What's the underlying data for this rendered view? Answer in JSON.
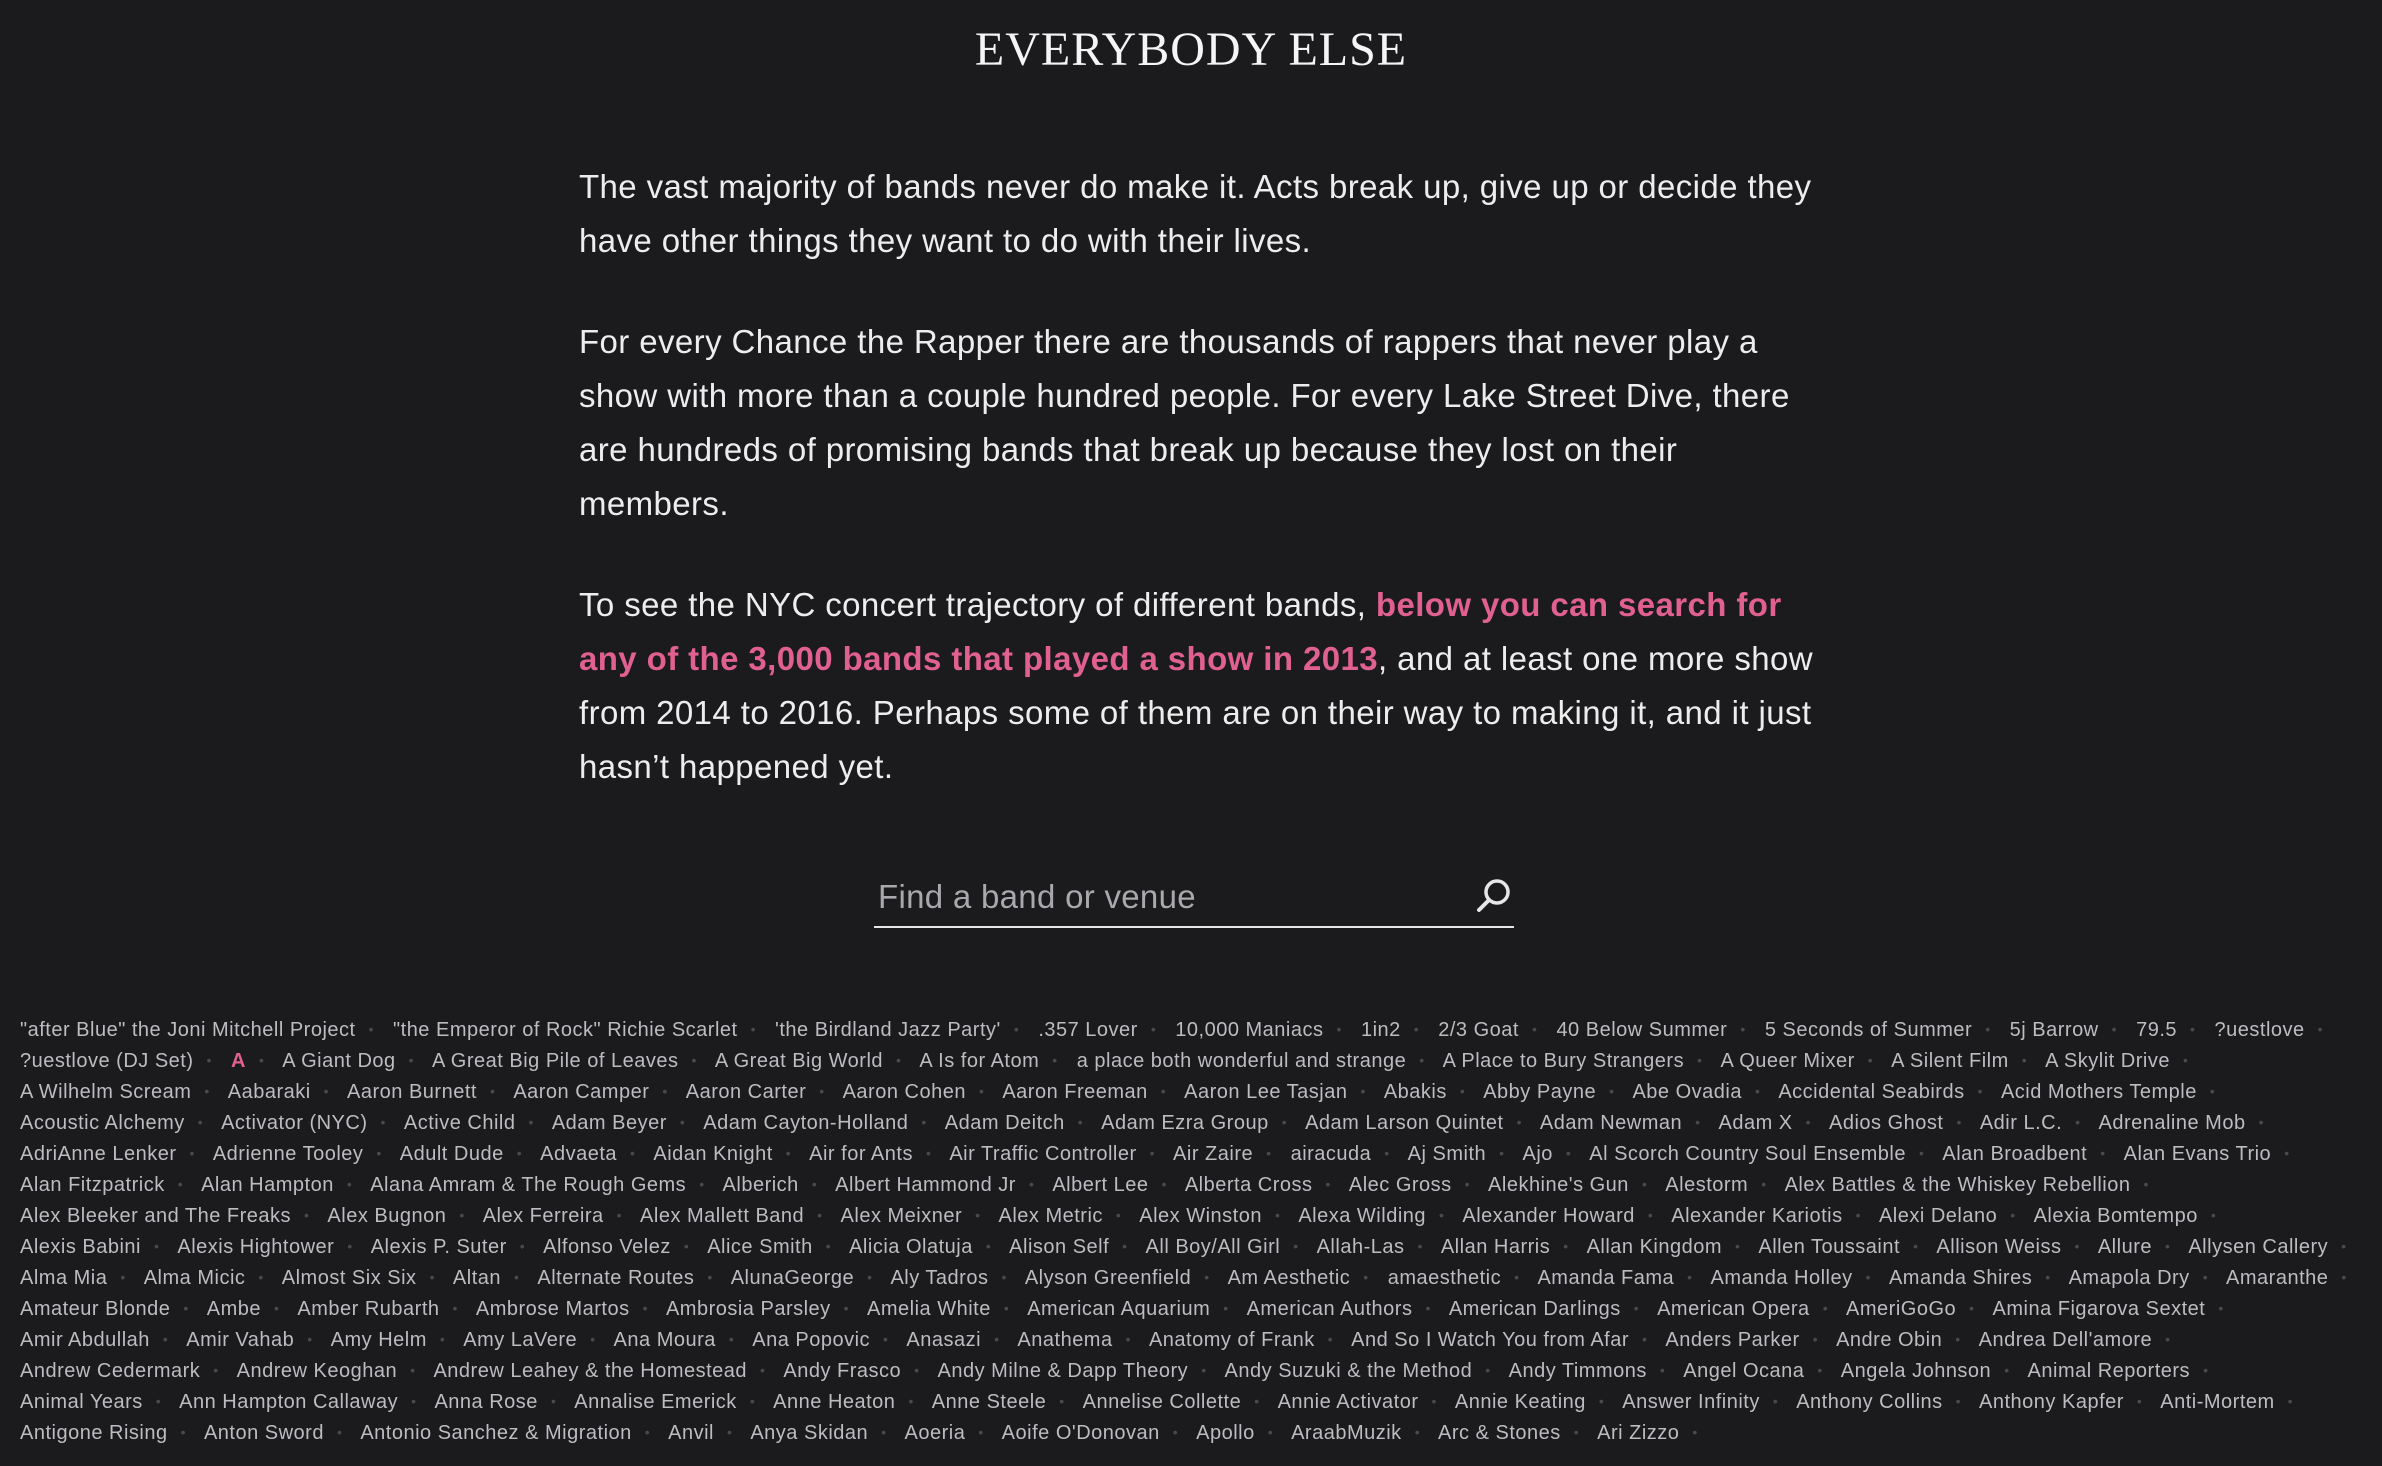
{
  "header": {
    "title": "EVERYBODY ELSE"
  },
  "intro": {
    "p1": "The vast majority of bands never do make it. Acts break up, give up or decide they have other things they want to do with their lives.",
    "p2": "For every Chance the Rapper there are thousands of rappers that never play a show with more than a couple hundred people. For every Lake Street Dive, there are hundreds of promising bands that break up because they lost on their members.",
    "p3_before": "To see the NYC concert trajectory of different bands, ",
    "p3_highlight": "below you can search for any of the 3,000 bands that played a show in 2013",
    "p3_after": ", and at least one more show from 2014 to 2016. Perhaps some of them are on their way to making it, and it just hasn’t happened yet."
  },
  "search": {
    "placeholder": "Find a band or venue",
    "value": "",
    "icon": "search-icon"
  },
  "colors": {
    "background": "#1b1a1d",
    "accent": "#e0618f",
    "text": "#f2f2f2",
    "band_text": "#bdbdc1"
  },
  "bands": [
    "\"after Blue\" the Joni Mitchell Project",
    "\"the Emperor of Rock\" Richie Scarlet",
    "'the Birdland Jazz Party'",
    ".357 Lover",
    "10,000 Maniacs",
    "1in2",
    "2/3 Goat",
    "40 Below Summer",
    "5 Seconds of Summer",
    "5j Barrow",
    "79.5",
    "?uestlove",
    "?uestlove (DJ Set)",
    "A",
    "A Giant Dog",
    "A Great Big Pile of Leaves",
    "A Great Big World",
    "A Is for Atom",
    "a place both wonderful and strange",
    "A Place to Bury Strangers",
    "A Queer Mixer",
    "A Silent Film",
    "A Skylit Drive",
    "A Wilhelm Scream",
    "Aabaraki",
    "Aaron Burnett",
    "Aaron Camper",
    "Aaron Carter",
    "Aaron Cohen",
    "Aaron Freeman",
    "Aaron Lee Tasjan",
    "Abakis",
    "Abby Payne",
    "Abe Ovadia",
    "Accidental Seabirds",
    "Acid Mothers Temple",
    "Acoustic Alchemy",
    "Activator (NYC)",
    "Active Child",
    "Adam Beyer",
    "Adam Cayton-Holland",
    "Adam Deitch",
    "Adam Ezra Group",
    "Adam Larson Quintet",
    "Adam Newman",
    "Adam X",
    "Adios Ghost",
    "Adir L.C.",
    "Adrenaline Mob",
    "AdriAnne Lenker",
    "Adrienne Tooley",
    "Adult Dude",
    "Advaeta",
    "Aidan Knight",
    "Air for Ants",
    "Air Traffic Controller",
    "Air Zaire",
    "airacuda",
    "Aj Smith",
    "Ajo",
    "Al Scorch Country Soul Ensemble",
    "Alan Broadbent",
    "Alan Evans Trio",
    "Alan Fitzpatrick",
    "Alan Hampton",
    "Alana Amram & The Rough Gems",
    "Alberich",
    "Albert Hammond Jr",
    "Albert Lee",
    "Alberta Cross",
    "Alec Gross",
    "Alekhine's Gun",
    "Alestorm",
    "Alex Battles & the Whiskey Rebellion",
    "Alex Bleeker and The Freaks",
    "Alex Bugnon",
    "Alex Ferreira",
    "Alex Mallett Band",
    "Alex Meixner",
    "Alex Metric",
    "Alex Winston",
    "Alexa Wilding",
    "Alexander Howard",
    "Alexander Kariotis",
    "Alexi Delano",
    "Alexia Bomtempo",
    "Alexis Babini",
    "Alexis Hightower",
    "Alexis P. Suter",
    "Alfonso Velez",
    "Alice Smith",
    "Alicia Olatuja",
    "Alison Self",
    "All Boy/All Girl",
    "Allah-Las",
    "Allan Harris",
    "Allan Kingdom",
    "Allen Toussaint",
    "Allison Weiss",
    "Allure",
    "Allysen Callery",
    "Alma Mia",
    "Alma Micic",
    "Almost Six Six",
    "Altan",
    "Alternate Routes",
    "AlunaGeorge",
    "Aly Tadros",
    "Alyson Greenfield",
    "Am Aesthetic",
    "amaesthetic",
    "Amanda Fama",
    "Amanda Holley",
    "Amanda Shires",
    "Amapola Dry",
    "Amaranthe",
    "Amateur Blonde",
    "Ambe",
    "Amber Rubarth",
    "Ambrose Martos",
    "Ambrosia Parsley",
    "Amelia White",
    "American Aquarium",
    "American Authors",
    "American Darlings",
    "American Opera",
    "AmeriGoGo",
    "Amina Figarova Sextet",
    "Amir Abdullah",
    "Amir Vahab",
    "Amy Helm",
    "Amy LaVere",
    "Ana Moura",
    "Ana Popovic",
    "Anasazi",
    "Anathema",
    "Anatomy of Frank",
    "And So I Watch You from Afar",
    "Anders Parker",
    "Andre Obin",
    "Andrea Dell'amore",
    "Andrew Cedermark",
    "Andrew Keoghan",
    "Andrew Leahey & the Homestead",
    "Andy Frasco",
    "Andy Milne & Dapp Theory",
    "Andy Suzuki & the Method",
    "Andy Timmons",
    "Angel Ocana",
    "Angela Johnson",
    "Animal Reporters",
    "Animal Years",
    "Ann Hampton Callaway",
    "Anna Rose",
    "Annalise Emerick",
    "Anne Heaton",
    "Anne Steele",
    "Annelise Collette",
    "Annie Activator",
    "Annie Keating",
    "Answer Infinity",
    "Anthony Collins",
    "Anthony Kapfer",
    "Anti-Mortem",
    "Antigone Rising",
    "Anton Sword",
    "Antonio Sanchez & Migration",
    "Anvil",
    "Anya Skidan",
    "Aoeria",
    "Aoife O'Donovan",
    "Apollo",
    "AraabMuzik",
    "Arc & Stones",
    "Ari Zizzo"
  ]
}
